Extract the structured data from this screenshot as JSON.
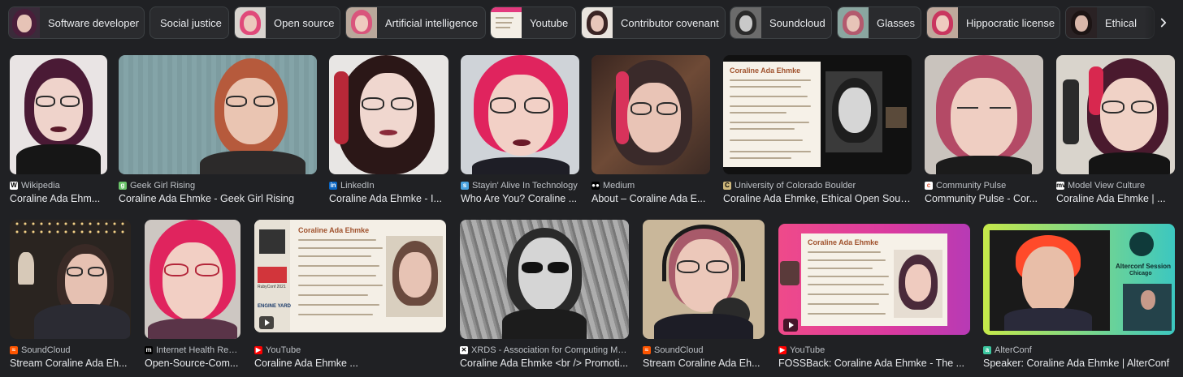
{
  "chips": [
    {
      "label": "Software developer",
      "thumb": "portrait"
    },
    {
      "label": "Social justice",
      "thumb": ""
    },
    {
      "label": "Open source",
      "thumb": "portrait"
    },
    {
      "label": "Artificial intelligence",
      "thumb": "portrait"
    },
    {
      "label": "Youtube",
      "thumb": "slide"
    },
    {
      "label": "Contributor covenant",
      "thumb": "portrait"
    },
    {
      "label": "Soundcloud",
      "thumb": "bw"
    },
    {
      "label": "Glasses",
      "thumb": "portrait"
    },
    {
      "label": "Hippocratic license",
      "thumb": "portrait"
    },
    {
      "label": "Ethical",
      "thumb": "portrait"
    }
  ],
  "chip_next_icon": "chevron-right-icon",
  "results_row1": [
    {
      "source": "Wikipedia",
      "title": "Coraline Ada Ehm..."
    },
    {
      "source": "Geek Girl Rising",
      "title": "Coraline Ada Ehmke - Geek Girl Rising"
    },
    {
      "source": "LinkedIn",
      "title": "Coraline Ada Ehmke - I..."
    },
    {
      "source": "Stayin' Alive In Technology",
      "title": "Who Are You? Coraline ..."
    },
    {
      "source": "Medium",
      "title": "About – Coraline Ada E..."
    },
    {
      "source": "University of Colorado Boulder",
      "title": "Coraline Ada Ehmke, Ethical Open Sour..."
    },
    {
      "source": "Community Pulse",
      "title": "Community Pulse - Cor..."
    },
    {
      "source": "Model View Culture",
      "title": "Coraline Ada Ehmke | ..."
    }
  ],
  "results_row2": [
    {
      "source": "SoundCloud",
      "title": "Stream Coraline Ada Eh..."
    },
    {
      "source": "Internet Health Rep...",
      "title": "Open-Source-Com..."
    },
    {
      "source": "YouTube",
      "title": "Coraline Ada Ehmke ..."
    },
    {
      "source": "XRDS - Association for Computing Mac...",
      "title": "Coraline Ada Ehmke <br /> Promoti..."
    },
    {
      "source": "SoundCloud",
      "title": "Stream Coraline Ada Eh..."
    },
    {
      "source": "YouTube",
      "title": "FOSSBack: Coraline Ada Ehmke - The ..."
    },
    {
      "source": "AlterConf",
      "title": "Speaker: Coraline Ada Ehmke | AlterConf"
    }
  ],
  "slides": {
    "colorado": {
      "title": "Coraline Ada Ehmke",
      "bullets": [
        "Nearly 30 years of professional experience in software development",
        "15 years in the open source community",
        "Creator of the Contributor Covenant",
        "Addressed the United Nations Forum on Business and Human Rights",
        "Author of the Hippocratic License",
        "Founder of the Ethical Source Movement"
      ]
    },
    "youtube1": {
      "title": "Coraline Ada Ehmke",
      "badge": "RubyConf 2021",
      "sponsor": "ENGINE YARD"
    },
    "fossback": {
      "title": "Coraline Ada Ehmke"
    },
    "alterconf": {
      "line1": "Alterconf Session",
      "line2": "Chicago"
    }
  },
  "colors": {
    "background": "#202124",
    "chip_bg": "#2a2b2e",
    "text_primary": "#e8eaed",
    "text_secondary": "#bdc1c6"
  }
}
